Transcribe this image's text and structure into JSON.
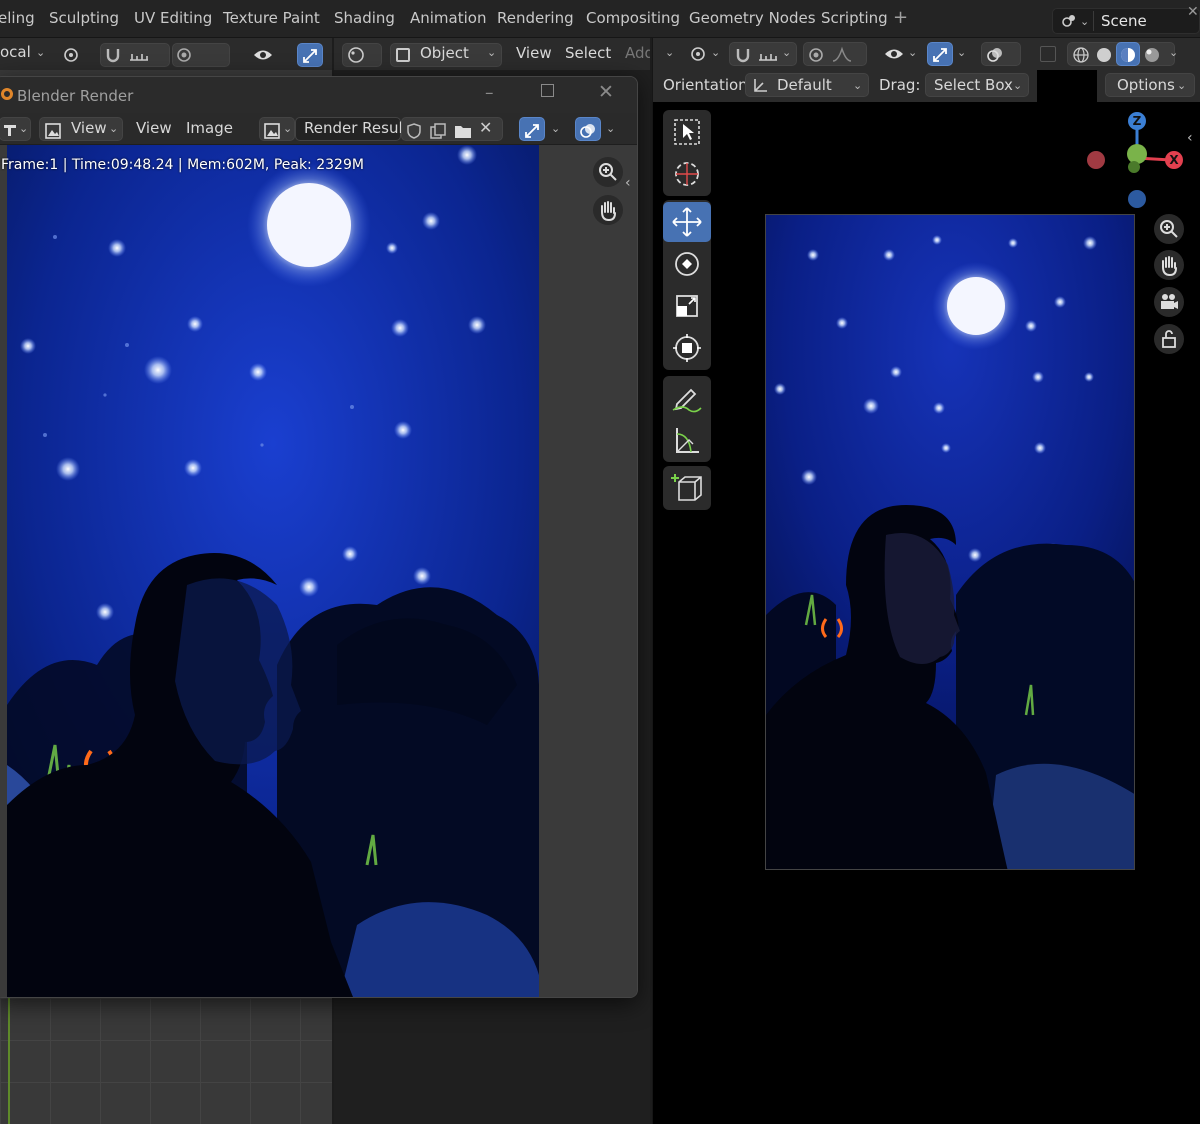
{
  "workspace_tabs": [
    "eling",
    "Sculpting",
    "UV Editing",
    "Texture Paint",
    "Shading",
    "Animation",
    "Rendering",
    "Compositing",
    "Geometry Nodes",
    "Scripting"
  ],
  "scene": {
    "label": "Scene"
  },
  "left_header": {
    "mode_label": "ocal"
  },
  "mid_header": {
    "mode_label": "Object",
    "menu_view": "View",
    "menu_select": "Select",
    "menu_add": "Add"
  },
  "render_window": {
    "title": "Blender Render",
    "menu_view": "View",
    "menu_view2": "View",
    "menu_image": "Image",
    "image_name": "Render Result",
    "info": "Frame:1 | Time:09:48.24 | Mem:602M, Peak: 2329M"
  },
  "right_viewport": {
    "orientation_label": "Orientation:",
    "orientation_value": "Default",
    "drag_label": "Drag:",
    "drag_value": "Select Box",
    "options_label": "Options",
    "gizmo": {
      "z": "Z",
      "x": "X",
      "colors": {
        "x": "#e2404f",
        "y": "#7ab34a",
        "z": "#3b7fd4"
      }
    }
  },
  "colors": {
    "accent": "#4772b3",
    "night_sky": "#0a1f7a",
    "moon": "#ffffff",
    "blender_orange": "#e0862a"
  }
}
